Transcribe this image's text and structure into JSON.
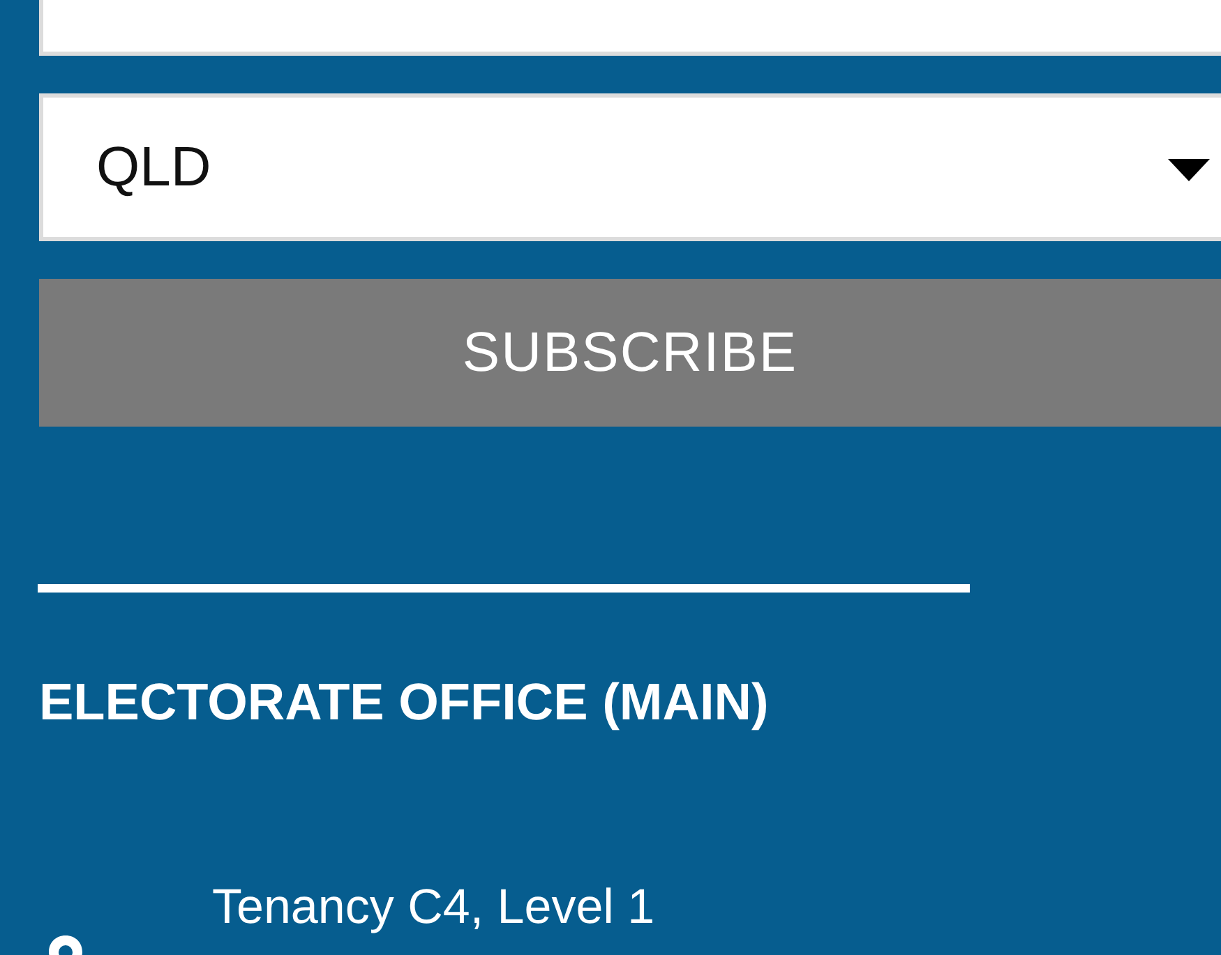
{
  "state_select": {
    "value": "QLD"
  },
  "subscribe_button": {
    "label": "SUBSCRIBE"
  },
  "office": {
    "heading": "ELECTORATE OFFICE (MAIN)",
    "address_line": "Tenancy C4, Level 1"
  }
}
